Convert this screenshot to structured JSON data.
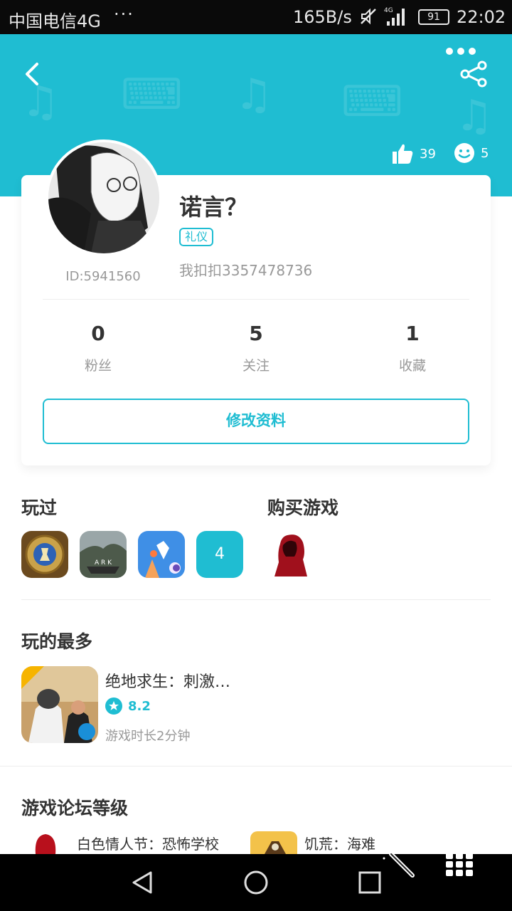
{
  "status_bar": {
    "carrier": "中国电信4G",
    "dots": "···",
    "speed": "165B/s",
    "network": "4G",
    "battery": "91",
    "time": "22:02"
  },
  "header": {
    "likes_count": "39",
    "smiles_count": "5"
  },
  "profile": {
    "username": "诺言？",
    "tag": "礼仪",
    "user_id": "ID:5941560",
    "bio": "我扣扣3357478736",
    "stats": [
      {
        "value": "0",
        "label": "粉丝"
      },
      {
        "value": "5",
        "label": "关注"
      },
      {
        "value": "1",
        "label": "收藏"
      }
    ],
    "edit_button": "修改资料"
  },
  "played": {
    "title": "玩过",
    "more_count": "4"
  },
  "purchased": {
    "title": "购买游戏"
  },
  "most_played": {
    "title": "玩的最多",
    "game_name": "绝地求生：刺激…",
    "rating": "8.2",
    "playtime": "游戏时长2分钟"
  },
  "forum_level": {
    "title": "游戏论坛等级",
    "items": [
      {
        "name": "白色情人节：恐怖学校"
      },
      {
        "name": "饥荒：海难"
      }
    ]
  },
  "colors": {
    "accent": "#1fbdd2",
    "status_bar_bg": "#0a0a0a"
  }
}
